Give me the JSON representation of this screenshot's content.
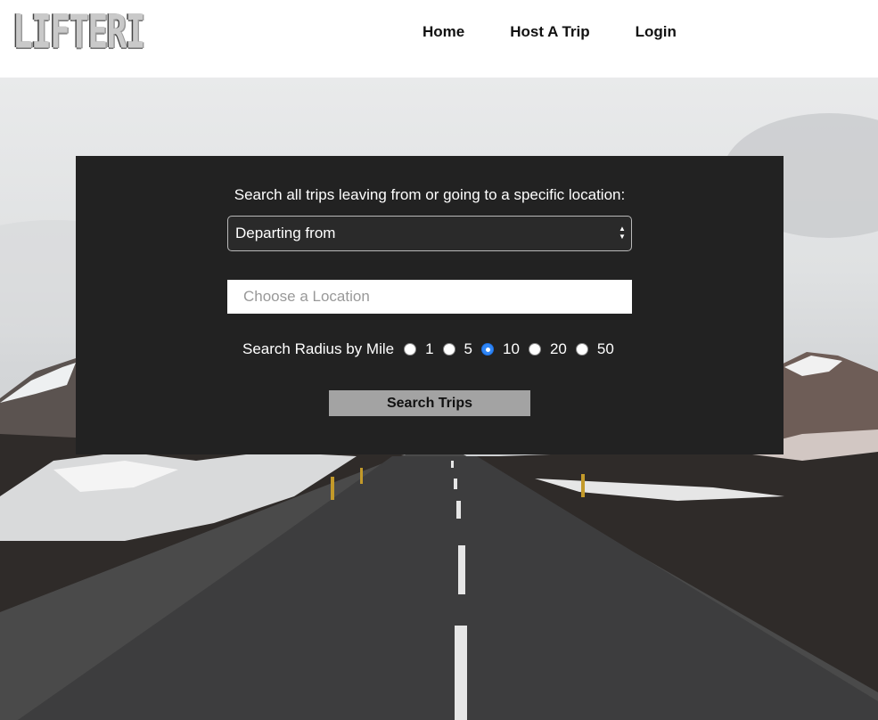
{
  "header": {
    "logo_text": "LIFTERI",
    "nav": [
      {
        "label": "Home"
      },
      {
        "label": "Host A Trip"
      },
      {
        "label": "Login"
      }
    ]
  },
  "search": {
    "prompt": "Search all trips leaving from or going to a specific location:",
    "direction_select": {
      "selected": "Departing from"
    },
    "location_placeholder": "Choose a Location",
    "radius_label": "Search Radius by Mile",
    "radius_options": [
      "1",
      "5",
      "10",
      "20",
      "50"
    ],
    "radius_selected": "10",
    "submit_label": "Search Trips"
  },
  "colors": {
    "panel_bg": "#222222",
    "button_bg": "#a3a3a3",
    "radio_checked": "#2f86f6"
  }
}
